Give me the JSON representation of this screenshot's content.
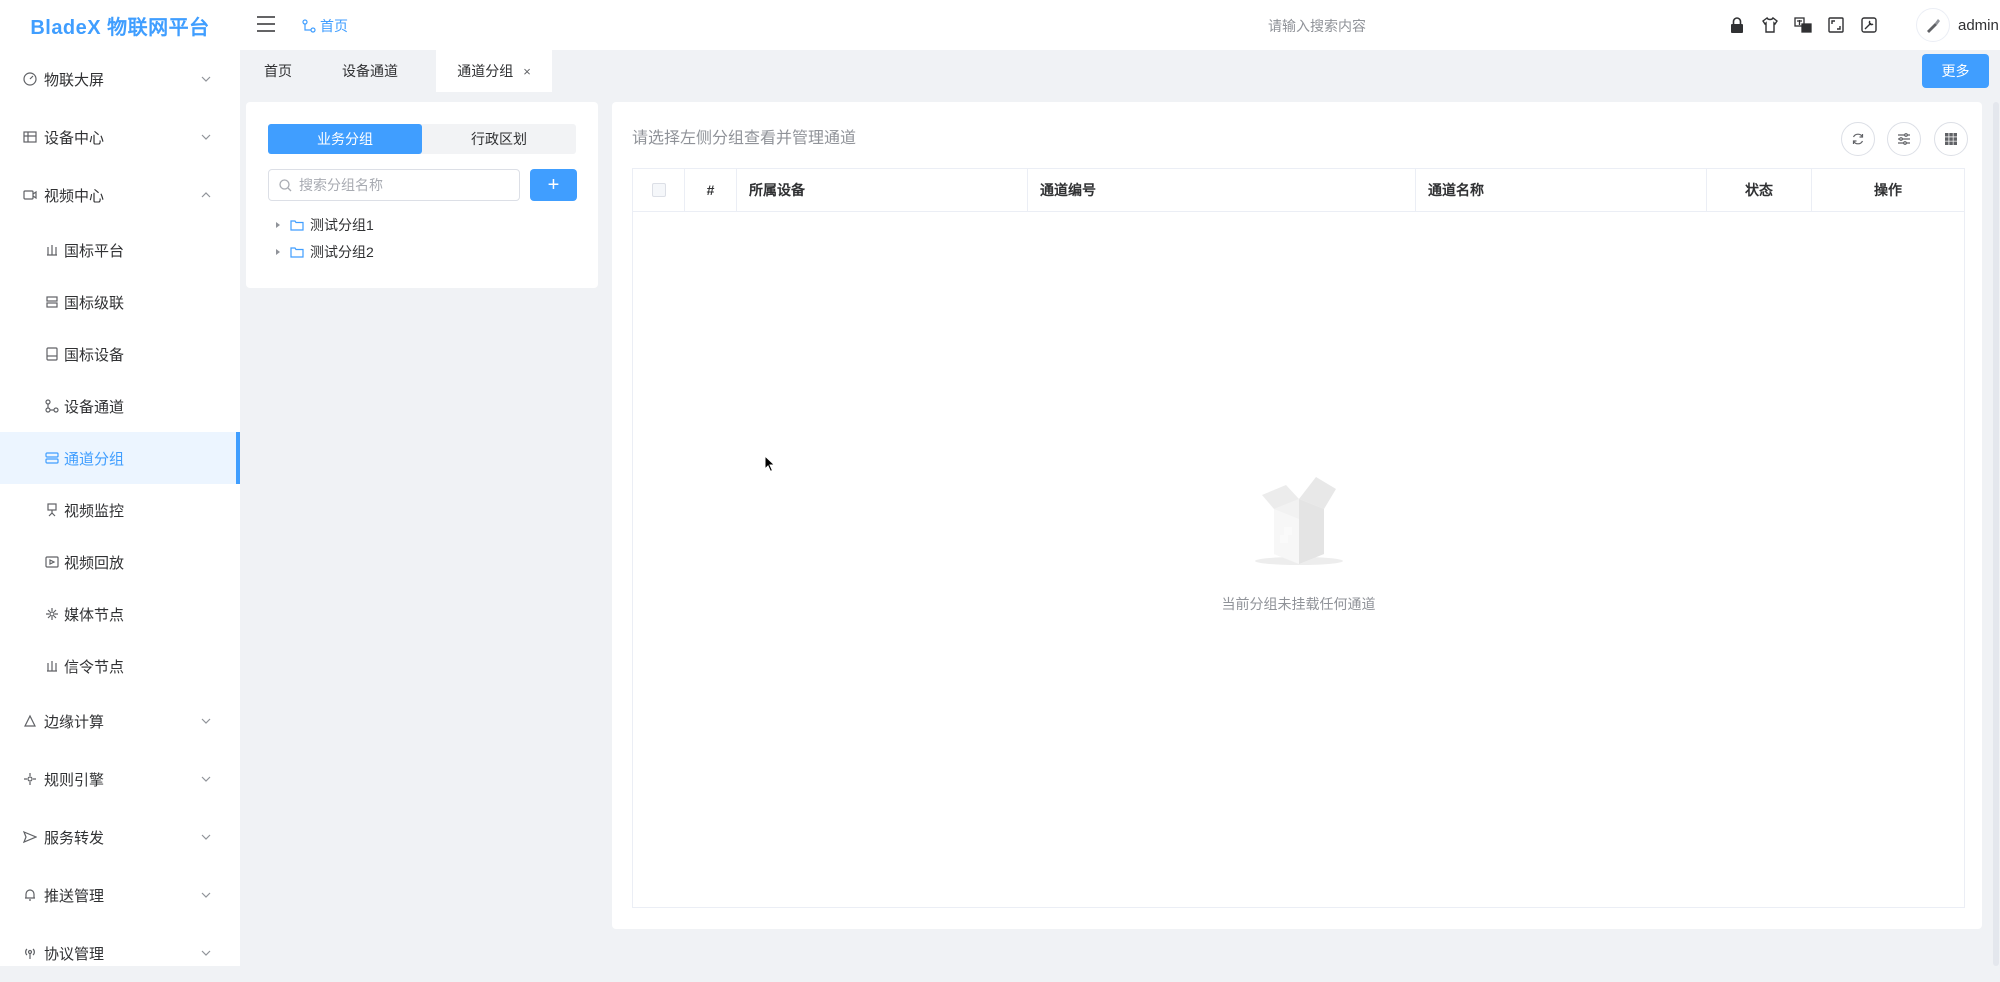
{
  "app": {
    "logo": "BladeX 物联网平台"
  },
  "sidebar": {
    "groups": [
      {
        "label": "物联大屏",
        "icon": "dashboard-icon",
        "expanded": false
      },
      {
        "label": "设备中心",
        "icon": "table-icon",
        "expanded": false
      },
      {
        "label": "视频中心",
        "icon": "video-camera-icon",
        "expanded": true
      }
    ],
    "sub_items": [
      {
        "label": "国标平台",
        "icon": "platform-icon"
      },
      {
        "label": "国标级联",
        "icon": "cascade-icon"
      },
      {
        "label": "国标设备",
        "icon": "device-icon"
      },
      {
        "label": "设备通道",
        "icon": "channel-icon"
      },
      {
        "label": "通道分组",
        "icon": "group-icon",
        "active": true
      },
      {
        "label": "视频监控",
        "icon": "monitor-icon"
      },
      {
        "label": "视频回放",
        "icon": "playback-icon"
      },
      {
        "label": "媒体节点",
        "icon": "media-node-icon"
      },
      {
        "label": "信令节点",
        "icon": "signal-node-icon"
      }
    ],
    "groups_after": [
      {
        "label": "边缘计算",
        "icon": "edge-icon",
        "expanded": false
      },
      {
        "label": "规则引擎",
        "icon": "rule-icon",
        "expanded": false
      },
      {
        "label": "服务转发",
        "icon": "send-icon",
        "expanded": false
      },
      {
        "label": "推送管理",
        "icon": "bell-icon",
        "expanded": false
      },
      {
        "label": "协议管理",
        "icon": "antenna-icon",
        "expanded": false
      }
    ]
  },
  "header": {
    "breadcrumb": "首页",
    "search_placeholder": "请输入搜索内容",
    "icons": [
      "lock-icon",
      "theme-shirt-icon",
      "language-icon",
      "fullscreen-icon",
      "settings-icon"
    ],
    "username": "admin"
  },
  "tabs": {
    "items": [
      {
        "label": "首页",
        "active": false,
        "closable": false
      },
      {
        "label": "设备通道",
        "active": false,
        "closable": false
      },
      {
        "label": "通道分组",
        "active": true,
        "closable": true
      }
    ],
    "close_symbol": "×",
    "more_label": "更多"
  },
  "group_panel": {
    "segments": [
      {
        "label": "业务分组",
        "active": true
      },
      {
        "label": "行政区划",
        "active": false
      }
    ],
    "search_placeholder": "搜索分组名称",
    "add_symbol": "+",
    "tree": [
      {
        "label": "测试分组1"
      },
      {
        "label": "测试分组2"
      }
    ]
  },
  "main": {
    "hint": "请选择左侧分组查看并管理通道",
    "toolbar_icons": [
      "refresh-icon",
      "filter-icon",
      "columns-icon"
    ],
    "table": {
      "columns": [
        "#",
        "所属设备",
        "通道编号",
        "通道名称",
        "状态",
        "操作"
      ],
      "rows": []
    },
    "empty_text": "当前分组未挂载任何通道"
  },
  "colors": {
    "accent": "#409eff",
    "background": "#f0f2f5"
  }
}
